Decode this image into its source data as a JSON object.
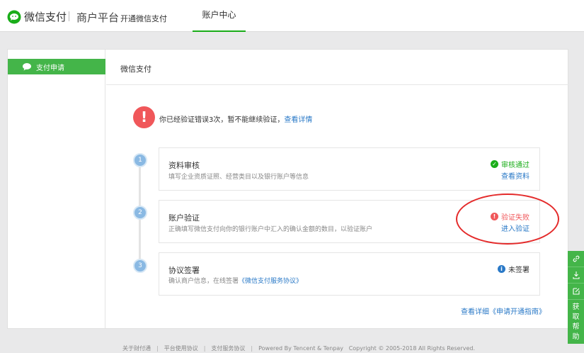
{
  "header": {
    "logo_text": "微信支付",
    "platform": "商户平台",
    "open_pay": "开通微信支付",
    "tab_account": "账户中心"
  },
  "sidebar": {
    "items": [
      {
        "label": "支付申请"
      }
    ]
  },
  "content": {
    "title": "微信支付",
    "alert": {
      "text": "你已经验证错误3次，暂不能继续验证，",
      "link": "查看详情"
    },
    "steps": [
      {
        "num": "1",
        "title": "资料审核",
        "desc": "填写企业资质证照、经营类目以及银行账户等信息",
        "status": "审核通过",
        "status_color": "#1aad19",
        "action": "查看资料"
      },
      {
        "num": "2",
        "title": "账户验证",
        "desc": "正确填写微信支付向你的银行账户中汇入的确认金额的数目，以验证账户",
        "status": "验证失败",
        "status_color": "#f0575a",
        "action": "进入验证"
      },
      {
        "num": "3",
        "title": "协议签署",
        "desc_prefix": "确认商户信息，在线签署",
        "desc_link": "《微信支付服务协议》",
        "status": "未签署",
        "status_color": "#2a79c7"
      }
    ],
    "guide_link": "查看详细《申请开通指南》"
  },
  "helpbar": {
    "help_label_1": "获",
    "help_label_2": "取",
    "help_label_3": "帮",
    "help_label_4": "助"
  },
  "footer": {
    "links": [
      "关于财付通",
      "平台使用协议",
      "支付服务协议"
    ],
    "powered": "Powered By Tencent & Tenpay",
    "copyright": "Copyright © 2005-2018 All Rights Reserved."
  },
  "colors": {
    "brand_green": "#44b549",
    "error_red": "#f0575a",
    "link_blue": "#2a79c7",
    "annotation_red": "#e42a2a"
  }
}
